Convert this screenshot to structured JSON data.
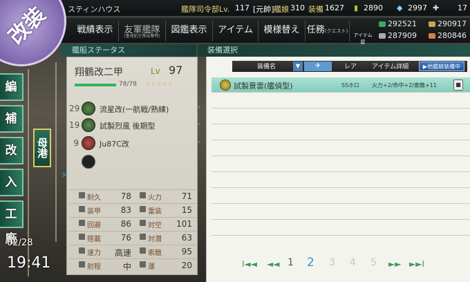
{
  "topbar": {
    "location": "スティンハウス",
    "admiral_label": "艦隊司令部Lv.",
    "admiral_level": "117",
    "rank": "[元帥]",
    "ships_label": "艦娘",
    "ships_count": "310",
    "equip_label": "装備",
    "equip_count": "1627",
    "resource_top_1": "2890",
    "resource_top_2": "2997",
    "resource_top_3": "17"
  },
  "menu": {
    "items": [
      {
        "label": "戦績表示"
      },
      {
        "label": "友軍艦隊",
        "sub": "(基地航空隊出撃時)"
      },
      {
        "label": "図鑑表示"
      },
      {
        "label": "アイテム"
      },
      {
        "label": "模様替え"
      },
      {
        "label": "任務",
        "sub2": "(クエスト)"
      }
    ],
    "item_shop": "アイテム屋",
    "resources": {
      "fuel": "292521",
      "ammo": "290917",
      "steel": "287909",
      "bauxite": "280846"
    }
  },
  "sidebar": {
    "big_label": "改装",
    "buttons": [
      "編成",
      "補給",
      "改装",
      "入渠",
      "工廠"
    ],
    "port": "母港",
    "date": "02/28",
    "time": "19:41"
  },
  "status": {
    "header": "艦船ステータス",
    "ship_name": "翔鶴改二甲",
    "lv_label": "Lv",
    "level": "97",
    "hp_text": "78/78",
    "hp_fraction": 1.0,
    "stars": "☆☆☆☆☆",
    "slots": [
      {
        "num": "29",
        "name": "流星改(一航戦/熟練)"
      },
      {
        "num": "19",
        "name": "試製烈風 後期型"
      },
      {
        "num": "9",
        "name": "Ju87C改"
      }
    ],
    "stats": [
      {
        "l": "耐久",
        "v": "78",
        "r": "火力",
        "rv": "71"
      },
      {
        "l": "装甲",
        "v": "83",
        "r": "雷装",
        "rv": "15"
      },
      {
        "l": "回避",
        "v": "86",
        "r": "対空",
        "rv": "101"
      },
      {
        "l": "搭載",
        "v": "76",
        "r": "対潜",
        "rv": "63"
      },
      {
        "l": "速力",
        "v": "高速",
        "r": "索敵",
        "rv": "95"
      },
      {
        "l": "射程",
        "v": "中",
        "r": "運",
        "rv": "20"
      }
    ]
  },
  "equip": {
    "header": "装備選択",
    "columns": {
      "name": "装備名",
      "rarity": "レア",
      "detail": "アイテム詳細"
    },
    "other_ship_btn": "▶他艦娘装備中",
    "rows": [
      {
        "name": "試製景雲(艦偵型)",
        "rarity": "SSホロ",
        "detail": "火力+2/命中+2/索敵+11",
        "selected": true
      }
    ],
    "pages": [
      "1",
      "2",
      "3",
      "4",
      "5"
    ],
    "current_page": "2"
  }
}
